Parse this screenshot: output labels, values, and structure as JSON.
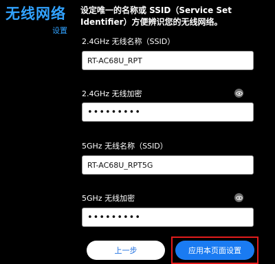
{
  "page": {
    "title": "无线网络",
    "subtitle": "设置",
    "intro": "设定唯一的名称或 SSID（Service Set Identifier）方便辨识您的无线网络。"
  },
  "fields": {
    "ssid_24": {
      "label": "2.4GHz 无线名称（SSID）",
      "value": "RT-AC68U_RPT"
    },
    "pwd_24": {
      "label": "2.4GHz 无线加密",
      "value": "•••••••••"
    },
    "ssid_5": {
      "label": "5GHz 无线名称（SSID）",
      "value": "RT-AC68U_RPT5G"
    },
    "pwd_5": {
      "label": "5GHz 无线加密",
      "value": "•••••••••"
    }
  },
  "icons": {
    "reveal_password": "eye-icon"
  },
  "buttons": {
    "back": "上一步",
    "apply": "应用本页面设置"
  },
  "colors": {
    "accent": "#31a2ff",
    "primary_button": "#1a7bf2",
    "highlight": "#e41c1c",
    "background": "#000000"
  }
}
